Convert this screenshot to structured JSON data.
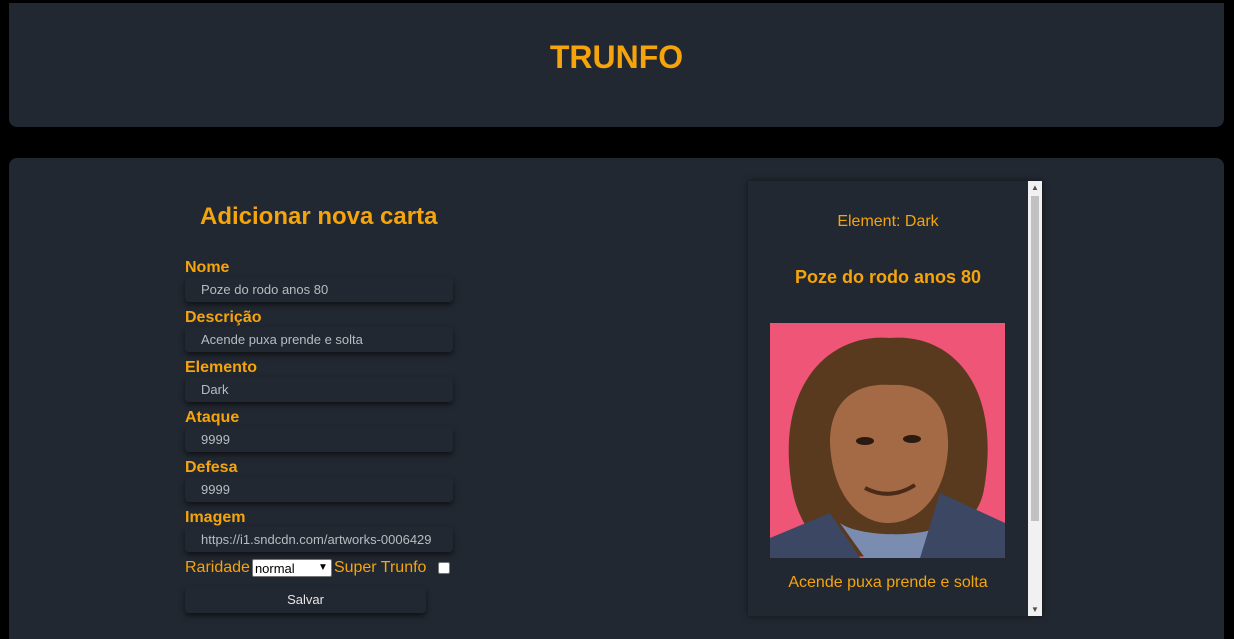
{
  "header": {
    "title": "TRUNFO"
  },
  "form": {
    "title": "Adicionar nova carta",
    "fields": [
      {
        "label": "Nome",
        "value": "Poze do rodo anos 80"
      },
      {
        "label": "Descrição",
        "value": "Acende puxa prende e solta"
      },
      {
        "label": "Elemento",
        "value": "Dark"
      },
      {
        "label": "Ataque",
        "value": "9999"
      },
      {
        "label": "Defesa",
        "value": "9999"
      },
      {
        "label": "Imagem",
        "value": "https://i1.sndcdn.com/artworks-0006429"
      }
    ],
    "rarity_label": "Raridade",
    "rarity_value": "normal",
    "super_trunfo_label": "Super Trunfo",
    "super_trunfo_checked": false,
    "save_label": "Salvar"
  },
  "card": {
    "element": "Element: Dark",
    "name": "Poze do rodo anos 80",
    "image": "portrait photo of a young man with 80s hairstyle on pink background",
    "description": "Acende puxa prende e solta"
  },
  "colors": {
    "accent": "#f5a40c",
    "panel": "#222831",
    "background": "#000000"
  }
}
